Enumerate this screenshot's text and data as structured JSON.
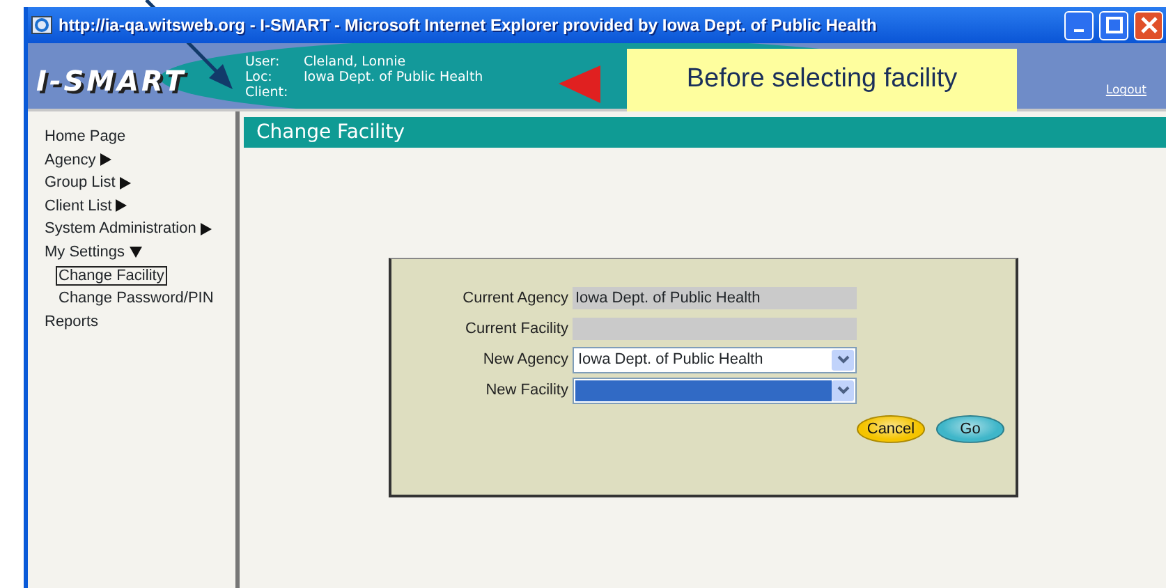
{
  "window": {
    "title": "http://ia-qa.witsweb.org - I-SMART - Microsoft Internet Explorer provided by Iowa Dept. of Public Health"
  },
  "header": {
    "logo": "I-SMART",
    "user_info": [
      {
        "label": "User:",
        "value": "Cleland, Lonnie"
      },
      {
        "label": "Loc:",
        "value": "Iowa Dept. of Public Health"
      },
      {
        "label": "Client:"
      }
    ],
    "logout": "Logout"
  },
  "annotation": {
    "callout": "Before selecting facility"
  },
  "sidebar": {
    "items": [
      {
        "label": "Home Page"
      },
      {
        "label": "Agency",
        "expanded": false
      },
      {
        "label": "Group List",
        "expanded": false
      },
      {
        "label": "Client List",
        "expanded": false
      },
      {
        "label": "System Administration",
        "expanded": false
      },
      {
        "label": "My Settings",
        "expanded": true,
        "children": [
          {
            "label": "Change Facility",
            "selected": true
          },
          {
            "label": "Change Password/PIN",
            "selected": false
          }
        ]
      },
      {
        "label": "Reports"
      }
    ]
  },
  "page_title": "Change Facility",
  "form": {
    "fields": [
      {
        "kind": "readonly",
        "label": "Current Agency",
        "value": "Iowa Dept. of Public Health"
      },
      {
        "kind": "readonly",
        "label": "Current Facility"
      },
      {
        "kind": "select",
        "label": "New Agency",
        "value": "Iowa Dept. of Public Health",
        "highlighted": false
      },
      {
        "kind": "select",
        "label": "New Facility",
        "highlighted": true
      }
    ],
    "buttons": [
      {
        "label": "Cancel",
        "color": "#f5c400"
      },
      {
        "label": "Go",
        "color": "#3fb6c9"
      }
    ]
  }
}
